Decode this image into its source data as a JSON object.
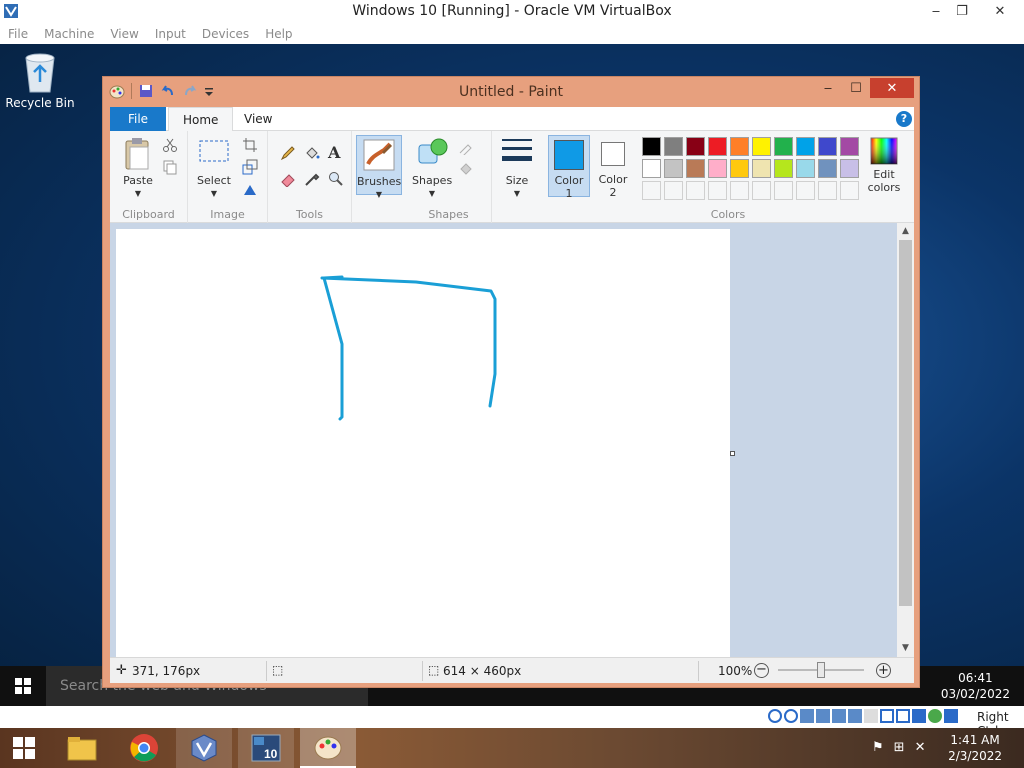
{
  "host": {
    "window_title": "Windows 10  [Running] - Oracle VM VirtualBox",
    "menu": [
      "File",
      "Machine",
      "View",
      "Input",
      "Devices",
      "Help"
    ],
    "host_key_label": "Right Ctrl",
    "clock_time": "1:41 AM",
    "clock_date": "2/3/2022"
  },
  "guest": {
    "desktop_icon_label": "Recycle Bin",
    "search_placeholder": "Search the web and Windows",
    "clock_time": "06:41",
    "clock_date": "03/02/2022"
  },
  "paint": {
    "window_title": "Untitled - Paint",
    "tabs": [
      "File",
      "Home",
      "View"
    ],
    "groups": {
      "clipboard": "Clipboard",
      "image": "Image",
      "tools": "Tools",
      "shapes": "Shapes",
      "colors": "Colors"
    },
    "buttons": {
      "paste": "Paste",
      "select": "Select",
      "brushes": "Brushes",
      "shapes": "Shapes",
      "size": "Size",
      "color1_line1": "Color",
      "color1_line2": "1",
      "color2_line1": "Color",
      "color2_line2": "2",
      "edit_colors_line1": "Edit",
      "edit_colors_line2": "colors"
    },
    "color1": "#0f9ae6",
    "color2": "#ffffff",
    "palette_row1": [
      "#000000",
      "#7f7f7f",
      "#880015",
      "#ed1c24",
      "#ff7f27",
      "#fff200",
      "#22b14c",
      "#00a2e8",
      "#3f48cc",
      "#a349a4"
    ],
    "palette_row2": [
      "#ffffff",
      "#c3c3c3",
      "#b97a57",
      "#ffaec9",
      "#ffc90e",
      "#efe4b0",
      "#b5e61d",
      "#99d9ea",
      "#7092be",
      "#c8bfe7"
    ],
    "stroke_color": "#1a9fd6",
    "status": {
      "cursor_pos": "371, 176px",
      "canvas_size": "614 × 460px",
      "zoom": "100%",
      "zoom_level": 0.5
    }
  }
}
